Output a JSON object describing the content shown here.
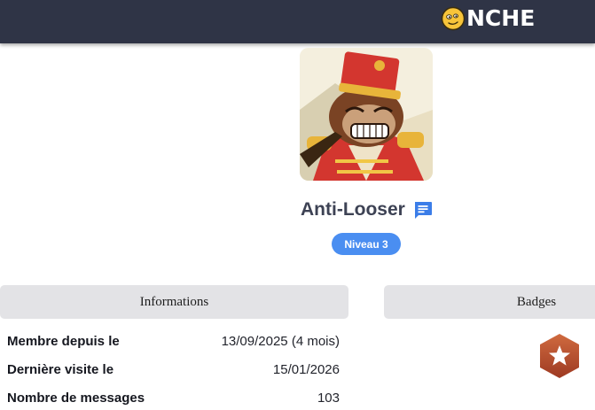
{
  "brand": {
    "logo_text": "NCHE",
    "logo_icon": "smiley-face-icon"
  },
  "profile": {
    "username": "Anti-Looser",
    "message_icon": "chat-icon",
    "level_label": "Niveau 3",
    "avatar": "cartoon-monkey-bandleader-avatar"
  },
  "informations": {
    "title": "Informations",
    "rows": [
      {
        "label": "Membre depuis le",
        "value": "13/09/2025 (4 mois)"
      },
      {
        "label": "Dernière visite le",
        "value": "15/01/2026"
      },
      {
        "label": "Nombre de messages",
        "value": "103"
      }
    ]
  },
  "badges": {
    "title": "Badges",
    "items": [
      {
        "icon": "star-hexagon-badge-icon",
        "color": "#b8502e"
      }
    ]
  },
  "colors": {
    "topbar": "#2f3446",
    "accent": "#4a8ef1",
    "panel_header": "#e3e3e6"
  }
}
